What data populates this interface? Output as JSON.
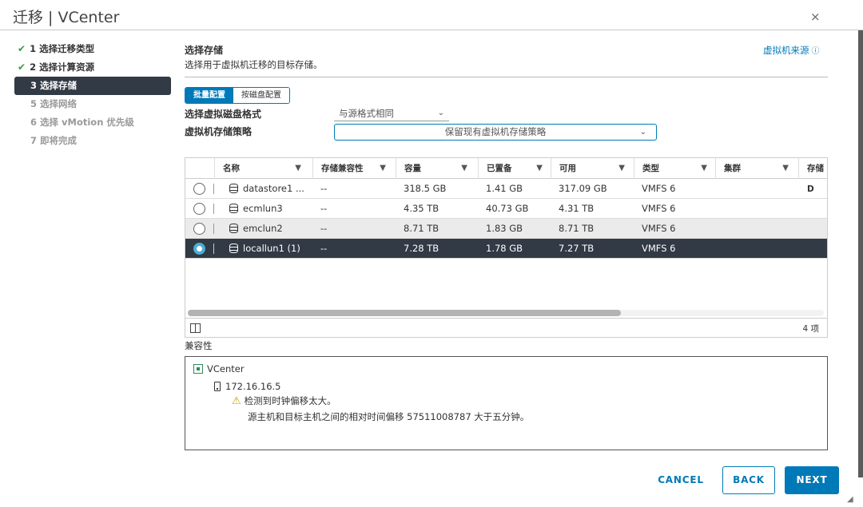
{
  "window": {
    "title": "迁移 | VCenter",
    "close_glyph": "×"
  },
  "steps": [
    {
      "label": "1 选择迁移类型",
      "state": "done"
    },
    {
      "label": "2 选择计算资源",
      "state": "done"
    },
    {
      "label": "3 选择存储",
      "state": "active"
    },
    {
      "label": "5 选择网络",
      "state": "pending"
    },
    {
      "label": "6 选择 vMotion 优先级",
      "state": "pending"
    },
    {
      "label": "7 即将完成",
      "state": "pending"
    }
  ],
  "header": {
    "title": "选择存储",
    "description": "选择用于虚拟机迁移的目标存储。",
    "vm_source_link": "虚拟机来源",
    "info_glyph": "ⓘ"
  },
  "config_toggle": {
    "batch": "批量配置",
    "per_disk": "按磁盘配置",
    "selected": "batch"
  },
  "form": {
    "disk_format_label": "选择虚拟磁盘格式",
    "disk_format_value": "与源格式相同",
    "storage_policy_label": "虚拟机存储策略",
    "storage_policy_value": "保留现有虚拟机存储策略"
  },
  "grid": {
    "columns": [
      "名称",
      "存储兼容性",
      "容量",
      "已置备",
      "可用",
      "类型",
      "集群",
      "存储 D"
    ],
    "rows": [
      {
        "name": "datastore1 ...",
        "compat": "--",
        "capacity": "318.5 GB",
        "provisioned": "1.41 GB",
        "free": "317.09 GB",
        "type": "VMFS 6",
        "cluster": "",
        "selected": false
      },
      {
        "name": "ecmlun3",
        "compat": "--",
        "capacity": "4.35 TB",
        "provisioned": "40.73 GB",
        "free": "4.31 TB",
        "type": "VMFS 6",
        "cluster": "",
        "selected": false
      },
      {
        "name": "emclun2",
        "compat": "--",
        "capacity": "8.71 TB",
        "provisioned": "1.83 GB",
        "free": "8.71 TB",
        "type": "VMFS 6",
        "cluster": "",
        "selected": false
      },
      {
        "name": "locallun1 (1)",
        "compat": "--",
        "capacity": "7.28 TB",
        "provisioned": "1.78 GB",
        "free": "7.27 TB",
        "type": "VMFS 6",
        "cluster": "",
        "selected": true
      }
    ],
    "item_count": "4 项"
  },
  "compatibility": {
    "label": "兼容性",
    "vcenter": "VCenter",
    "host": "172.16.16.5",
    "warning_title": "检测到时钟偏移太大。",
    "warning_detail": "源主机和目标主机之间的相对时间偏移 57511008787 大于五分钟。"
  },
  "footer": {
    "cancel": "CANCEL",
    "back": "BACK",
    "next": "NEXT"
  },
  "colors": {
    "accent": "#0079b8",
    "selected_row": "#313a45",
    "success": "#3c9a3c"
  }
}
